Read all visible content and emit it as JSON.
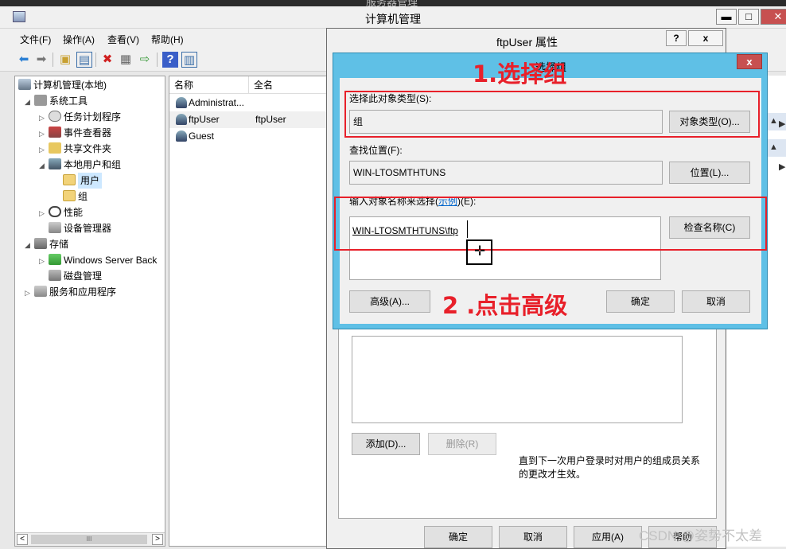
{
  "main_window": {
    "title": "计算机管理",
    "ghost_title": "服务器管理",
    "menu": [
      "文件(F)",
      "操作(A)",
      "查看(V)",
      "帮助(H)"
    ],
    "window_buttons": {
      "minimize": "▬",
      "maximize": "□",
      "close": "✕"
    }
  },
  "toolbar_icons": [
    "back-arrow-icon",
    "forward-arrow-icon",
    "up-folder-icon",
    "show-hide-tree-icon",
    "delete-icon",
    "properties-icon",
    "export-icon",
    "help-icon",
    "view-icon"
  ],
  "tree": [
    {
      "label": "计算机管理(本地)",
      "level": 0,
      "arrow": ""
    },
    {
      "label": "系统工具",
      "level": 1,
      "arrow": "◢"
    },
    {
      "label": "任务计划程序",
      "level": 2,
      "arrow": "▷"
    },
    {
      "label": "事件查看器",
      "level": 2,
      "arrow": "▷"
    },
    {
      "label": "共享文件夹",
      "level": 2,
      "arrow": "▷"
    },
    {
      "label": "本地用户和组",
      "level": 2,
      "arrow": "◢"
    },
    {
      "label": "用户",
      "level": 3,
      "arrow": "",
      "selected": true
    },
    {
      "label": "组",
      "level": 3,
      "arrow": ""
    },
    {
      "label": "性能",
      "level": 2,
      "arrow": "▷"
    },
    {
      "label": "设备管理器",
      "level": 2,
      "arrow": ""
    },
    {
      "label": "存储",
      "level": 1,
      "arrow": "◢"
    },
    {
      "label": "Windows Server Back",
      "level": 2,
      "arrow": "▷"
    },
    {
      "label": "磁盘管理",
      "level": 2,
      "arrow": ""
    },
    {
      "label": "服务和应用程序",
      "level": 1,
      "arrow": "▷"
    }
  ],
  "tree_scroll": {
    "left": "<",
    "right": ">",
    "thumb": "III"
  },
  "list": {
    "columns": [
      "名称",
      "全名"
    ],
    "rows": [
      {
        "name": "Administrat...",
        "fullname": ""
      },
      {
        "name": "ftpUser",
        "fullname": "ftpUser"
      },
      {
        "name": "Guest",
        "fullname": ""
      }
    ]
  },
  "props_dialog": {
    "title": "ftpUser 属性",
    "help_btn": "?",
    "close_btn": "x",
    "add_btn": "添加(D)...",
    "remove_btn": "删除(R)",
    "note": "直到下一次用户登录时对用户的组成员关系的更改才生效。",
    "ok": "确定",
    "cancel": "取消",
    "apply": "应用(A)",
    "help": "帮助"
  },
  "select_dialog": {
    "title": "选择组",
    "close": "x",
    "object_type_label": "选择此对象类型(S):",
    "object_type_value": "组",
    "object_type_btn": "对象类型(O)...",
    "location_label": "查找位置(F):",
    "location_value": "WIN-LTOSMTHTUNS",
    "location_btn": "位置(L)...",
    "names_label_prefix": "输入对象名称来选择(",
    "names_label_link": "示例",
    "names_label_suffix": ")(E):",
    "names_value": "WIN-LTOSMTHTUNS\\ftp",
    "check_btn": "检查名称(C)",
    "advanced_btn": "高级(A)...",
    "ok": "确定",
    "cancel": "取消"
  },
  "annotations": {
    "step1": "1.选择组",
    "step2": "2 .点击高级",
    "color": "#e8202a"
  },
  "cursor_glyph": "✛",
  "watermark": "CSDN @姿势不太差"
}
